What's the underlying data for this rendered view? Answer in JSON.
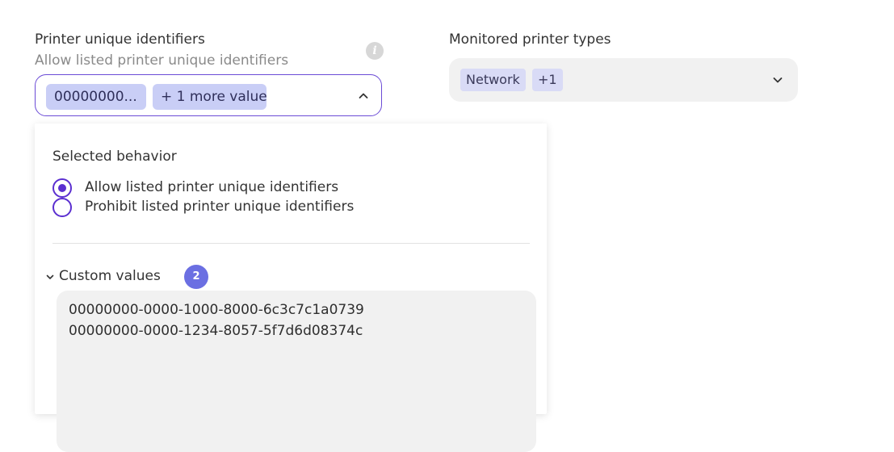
{
  "printer_ids": {
    "label": "Printer unique identifiers",
    "sublabel": "Allow listed printer unique identifiers",
    "info_icon": "info-icon",
    "chips": [
      "00000000...",
      "+ 1 more value"
    ],
    "toggle_icon": "chevron-up-icon"
  },
  "printer_types": {
    "label": "Monitored printer types",
    "chips": [
      "Network",
      "+1"
    ],
    "toggle_icon": "chevron-down-icon"
  },
  "dropdown": {
    "behavior_heading": "Selected behavior",
    "options": [
      {
        "label": "Allow listed printer unique identifiers",
        "selected": true
      },
      {
        "label": "Prohibit listed printer unique identifiers",
        "selected": false
      }
    ],
    "custom_values": {
      "label": "Custom values",
      "count": "2",
      "values_text": "00000000-0000-1000-8000-6c3c7c1a0739\n00000000-0000-1234-8057-5f7d6d08374c"
    }
  },
  "colors": {
    "accent": "#5b2fd0",
    "chip_bg": "#c9cef6",
    "badge": "#6b6fe2",
    "field_bg": "#f1f1f1"
  }
}
